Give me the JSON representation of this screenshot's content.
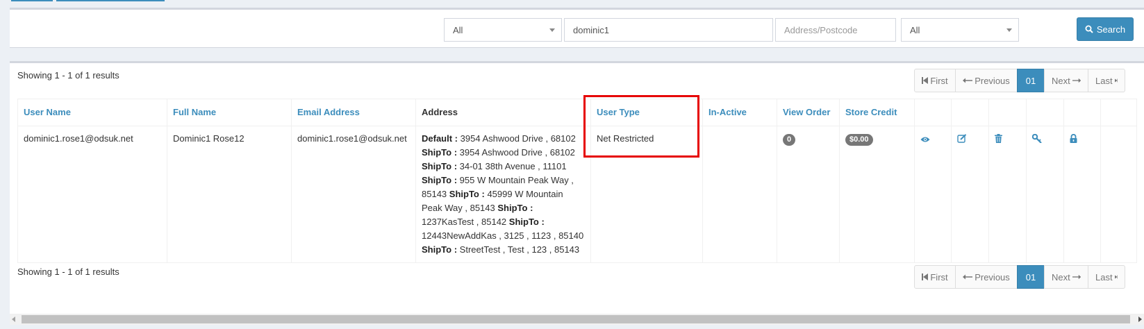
{
  "colors": {
    "accent": "#3c8dbc",
    "highlight": "#e60000",
    "badge": "#777777"
  },
  "filters": {
    "type_select": "All",
    "search_value": "dominic1",
    "address_placeholder": "Address/Postcode",
    "status_select": "All",
    "search_button": "Search"
  },
  "results": {
    "showing_top": "Showing 1 - 1 of 1 results",
    "showing_bottom": "Showing 1 - 1 of 1 results"
  },
  "pagination": {
    "first": "First",
    "previous": "Previous",
    "current": "01",
    "next": "Next",
    "last": "Last"
  },
  "table": {
    "headers": {
      "user_name": "User Name",
      "full_name": "Full Name",
      "email": "Email Address",
      "address": "Address",
      "user_type": "User Type",
      "inactive": "In-Active",
      "view_order": "View Order",
      "store_credit": "Store Credit"
    },
    "row": {
      "user_name": "dominic1.rose1@odsuk.net",
      "full_name": "Dominic1 Rose12",
      "email": "dominic1.rose1@odsuk.net",
      "address": [
        {
          "label": "Default :",
          "value": "3954 Ashwood Drive , 68102"
        },
        {
          "label": "ShipTo :",
          "value": "3954 Ashwood Drive , 68102"
        },
        {
          "label": "ShipTo :",
          "value": "34-01 38th Avenue , 11101"
        },
        {
          "label": "ShipTo :",
          "value": "955 W Mountain Peak Way , 85143"
        },
        {
          "label": "ShipTo :",
          "value": "45999 W Mountain Peak Way , 85143"
        },
        {
          "label": "ShipTo :",
          "value": "1237KasTest , 85142"
        },
        {
          "label": "ShipTo :",
          "value": "12443NewAddKas , 3125 , 1123 , 85140"
        },
        {
          "label": "ShipTo :",
          "value": "StreetTest , Test , 123 , 85143"
        }
      ],
      "user_type": "Net Restricted",
      "inactive": "",
      "view_order": "0",
      "store_credit": "$0.00",
      "actions": [
        "eye-icon",
        "edit-icon",
        "trash-icon",
        "key-icon",
        "lock-icon"
      ]
    }
  }
}
